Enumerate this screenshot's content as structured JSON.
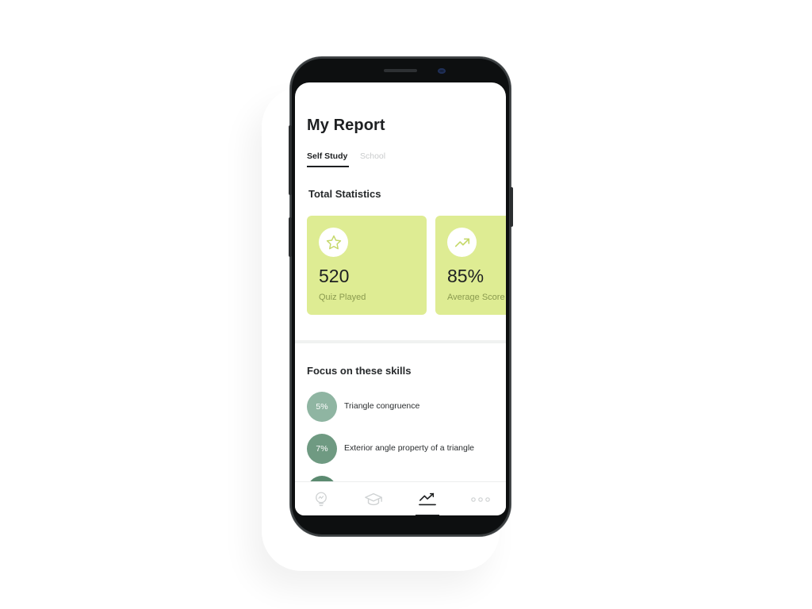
{
  "header": {
    "title": "My Report"
  },
  "tabs": [
    {
      "label": "Self Study",
      "active": true
    },
    {
      "label": "School",
      "active": false
    }
  ],
  "statistics": {
    "title": "Total Statistics",
    "cards": [
      {
        "icon": "star-icon",
        "value": "520",
        "label": "Quiz Played"
      },
      {
        "icon": "trending-up-icon",
        "value": "85%",
        "label": "Average Score"
      }
    ]
  },
  "skills": {
    "title": "Focus on these skills",
    "items": [
      {
        "percent": "5%",
        "name": "Triangle congruence",
        "color": "#8fb5a2"
      },
      {
        "percent": "7%",
        "name": "Exterior angle property of a triangle",
        "color": "#6f9a82"
      }
    ]
  },
  "bottom_nav": {
    "items": [
      {
        "icon": "lightbulb-icon",
        "active": false
      },
      {
        "icon": "graduation-cap-icon",
        "active": false
      },
      {
        "icon": "report-chart-icon",
        "active": true
      },
      {
        "icon": "more-dots-icon",
        "active": false
      }
    ]
  },
  "colors": {
    "card_background": "#deec93",
    "card_label": "#8a9a4f",
    "text_primary": "#1e2022",
    "tab_inactive": "#c9cbcc"
  }
}
